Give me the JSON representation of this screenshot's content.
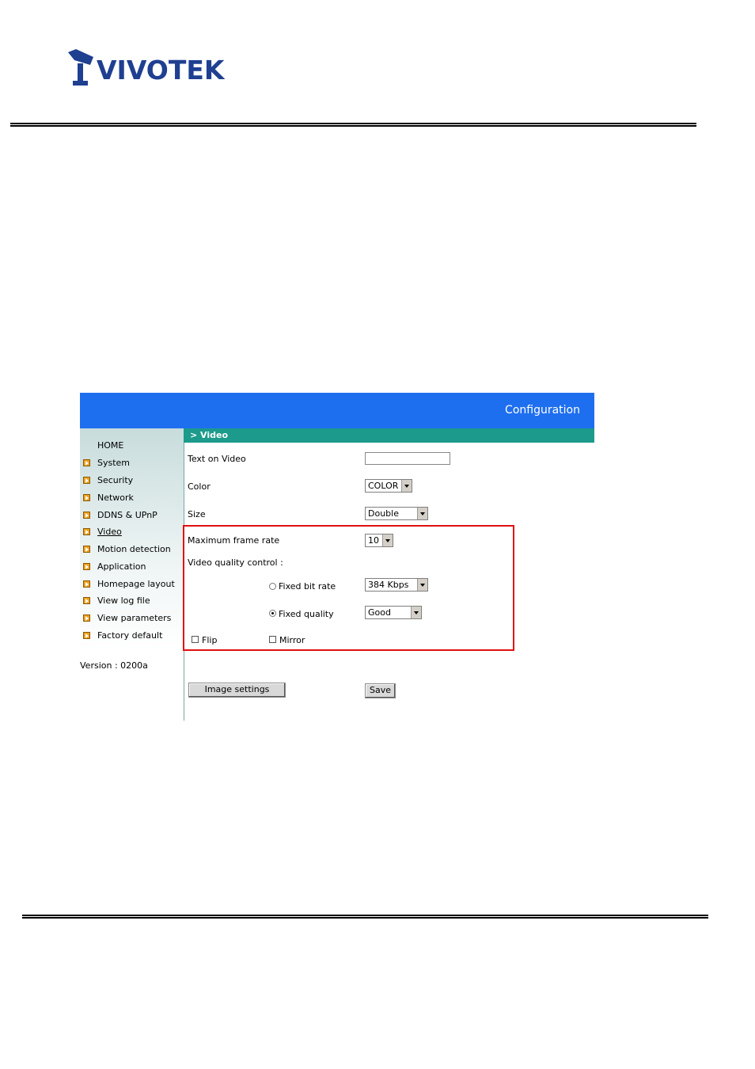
{
  "header": {
    "logo_text": "VIVOTEK"
  },
  "screenshot": {
    "banner_title": "Configuration",
    "section_title": "> Video",
    "nav": [
      {
        "label": "HOME"
      },
      {
        "label": "System"
      },
      {
        "label": "Security"
      },
      {
        "label": "Network"
      },
      {
        "label": "DDNS & UPnP"
      },
      {
        "label": "Video"
      },
      {
        "label": "Motion detection"
      },
      {
        "label": "Application"
      },
      {
        "label": "Homepage layout"
      },
      {
        "label": "View log file"
      },
      {
        "label": "View parameters"
      },
      {
        "label": "Factory default"
      }
    ],
    "version": "Version : 0200a",
    "form": {
      "text_on_video_label": "Text on Video",
      "text_on_video_value": "",
      "color_label": "Color",
      "color_value": "COLOR",
      "size_label": "Size",
      "size_value": "Double",
      "max_frame_rate_label": "Maximum frame rate",
      "max_frame_rate_value": "10",
      "quality_control_label": "Video quality control :",
      "fixed_bit_rate_label": "Fixed bit rate",
      "fixed_bit_rate_value": "384 Kbps",
      "fixed_bit_rate_selected": false,
      "fixed_quality_label": "Fixed quality",
      "fixed_quality_value": "Good",
      "fixed_quality_selected": true,
      "flip_label": "Flip",
      "flip_checked": false,
      "mirror_label": "Mirror",
      "mirror_checked": false,
      "image_settings_button": "Image settings",
      "save_button": "Save"
    },
    "highlight_color": "#e01010",
    "banner_color": "#1e6ff0",
    "section_color": "#1c9a8c"
  }
}
